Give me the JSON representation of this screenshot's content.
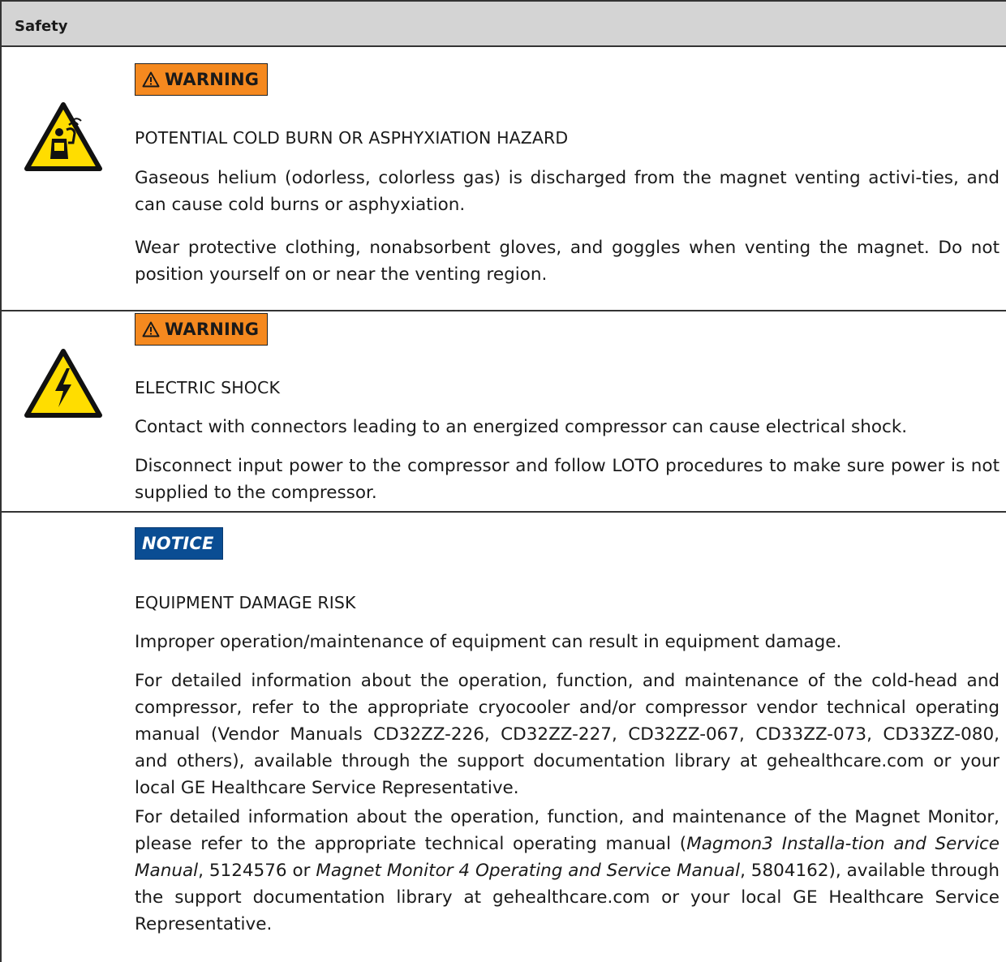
{
  "header": {
    "title": "Safety"
  },
  "sections": [
    {
      "signal_word": "WARNING",
      "symbol_icon": "asphyxiation-hazard-icon",
      "hazard": "POTENTIAL COLD BURN OR ASPHYXIATION HAZARD",
      "para1": "Gaseous helium (odorless, colorless gas) is discharged from the magnet venting activi-ties, and can cause cold burns or asphyxiation.",
      "para2": "Wear protective clothing, nonabsorbent gloves, and goggles when venting the magnet. Do not position yourself on or near the venting region."
    },
    {
      "signal_word": "WARNING",
      "symbol_icon": "electric-shock-hazard-icon",
      "hazard": "ELECTRIC SHOCK",
      "para1": "Contact with connectors leading to an energized compressor can cause electrical shock.",
      "para2": "Disconnect input power to the compressor and follow LOTO procedures to make sure power is not supplied to the compressor."
    },
    {
      "signal_word": "NOTICE",
      "hazard": "EQUIPMENT DAMAGE RISK",
      "para1": "Improper operation/maintenance of equipment can result in equipment damage.",
      "para2": "For detailed information about the operation, function, and maintenance of the cold-head and compressor, refer to the appropriate cryocooler and/or compressor vendor technical operating manual (Vendor Manuals CD32ZZ-226, CD32ZZ-227, CD32ZZ-067, CD33ZZ-073, CD33ZZ-080, and others), available through the support documentation library at gehealthcare.com or your local GE Healthcare Service Representative.",
      "para3": {
        "a": "For detailed information about the operation, function, and maintenance of the Magnet Monitor, please refer to the appropriate technical operating manual (",
        "b": "Magmon3 Installa-tion and Service Manual",
        "c": ", 5124576 or ",
        "d": "Magnet Monitor 4 Operating and Service Manual",
        "e": ", 5804162), available through the support documentation library at gehealthcare.com or your local GE Healthcare Service Representative."
      }
    }
  ],
  "colors": {
    "warning": "#f5891f",
    "notice": "#0a4d93",
    "hazard_yellow": "#ffdd00",
    "header_bg": "#d4d4d4"
  }
}
